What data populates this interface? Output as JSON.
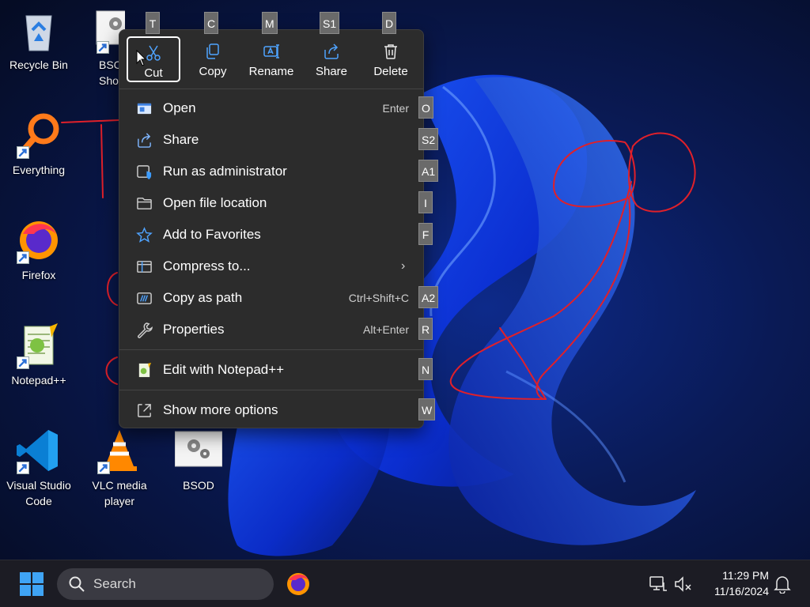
{
  "desktop": {
    "icons": [
      {
        "label": "Recycle Bin",
        "icon": "recycle-bin-icon"
      },
      {
        "label": "BSC\nShor",
        "icon": "settings-shortcut-icon"
      },
      {
        "label": "Everything",
        "icon": "everything-search-icon"
      },
      {
        "label": "Firefox",
        "icon": "firefox-icon"
      },
      {
        "label": "Notepad++",
        "icon": "notepad-plus-plus-icon"
      },
      {
        "label": "Visual Studio Code",
        "icon": "vscode-icon"
      },
      {
        "label": "VLC media player",
        "icon": "vlc-icon"
      },
      {
        "label": "BSOD",
        "icon": "settings-file-icon"
      }
    ]
  },
  "context_menu": {
    "quick_actions": [
      {
        "label": "Cut",
        "key": "T",
        "icon": "cut-icon",
        "selected": true
      },
      {
        "label": "Copy",
        "key": "C",
        "icon": "copy-icon"
      },
      {
        "label": "Rename",
        "key": "M",
        "icon": "rename-icon"
      },
      {
        "label": "Share",
        "key": "S1",
        "icon": "share-icon"
      },
      {
        "label": "Delete",
        "key": "D",
        "icon": "delete-icon"
      }
    ],
    "items": [
      {
        "label": "Open",
        "shortcut": "Enter",
        "key": "O",
        "icon": "open-icon"
      },
      {
        "label": "Share",
        "shortcut": "",
        "key": "S2",
        "icon": "share-icon"
      },
      {
        "label": "Run as administrator",
        "shortcut": "",
        "key": "A1",
        "icon": "shield-icon"
      },
      {
        "label": "Open file location",
        "shortcut": "",
        "key": "I",
        "icon": "folder-icon"
      },
      {
        "label": "Add to Favorites",
        "shortcut": "",
        "key": "F",
        "icon": "star-icon"
      },
      {
        "label": "Compress to...",
        "shortcut": "",
        "key": "",
        "icon": "archive-icon",
        "submenu": true
      },
      {
        "label": "Copy as path",
        "shortcut": "Ctrl+Shift+C",
        "key": "A2",
        "icon": "copy-path-icon"
      },
      {
        "label": "Properties",
        "shortcut": "Alt+Enter",
        "key": "R",
        "icon": "wrench-icon"
      },
      {
        "label": "Edit with Notepad++",
        "shortcut": "",
        "key": "N",
        "icon": "notepad-plus-plus-icon"
      },
      {
        "label": "Show more options",
        "shortcut": "",
        "key": "W",
        "icon": "more-options-icon"
      }
    ],
    "submenu_arrow": "›"
  },
  "taskbar": {
    "search_placeholder": "Search",
    "time": "11:29 PM",
    "date": "11/16/2024"
  },
  "colors": {
    "menu_bg": "#2c2c2c",
    "key_badge": "#6a6a6a",
    "scribble": "#e0202a",
    "taskbar_bg": "#1c1c24"
  }
}
